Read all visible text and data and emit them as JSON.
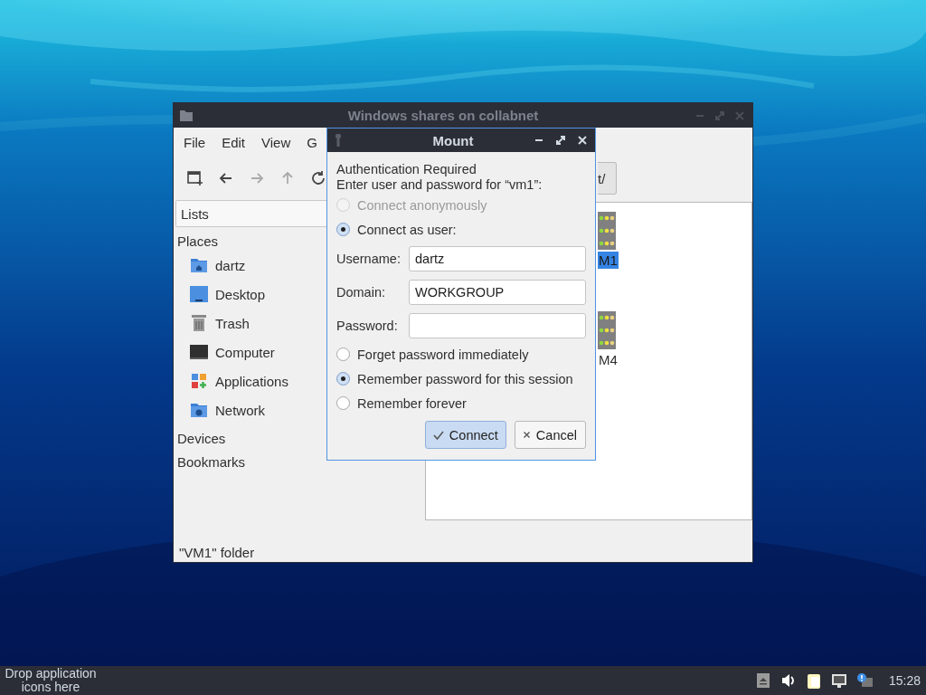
{
  "file_manager": {
    "title": "Windows shares on collabnet",
    "menu": [
      "File",
      "Edit",
      "View",
      "G"
    ],
    "path_tail": "t/",
    "sidebar": {
      "selector": "Lists",
      "sections": [
        {
          "label": "Places",
          "items": [
            {
              "label": "dartz",
              "kind": "home"
            },
            {
              "label": "Desktop",
              "kind": "desktop"
            },
            {
              "label": "Trash",
              "kind": "trash"
            },
            {
              "label": "Computer",
              "kind": "computer"
            },
            {
              "label": "Applications",
              "kind": "applications"
            },
            {
              "label": "Network",
              "kind": "network"
            }
          ]
        },
        {
          "label": "Devices"
        },
        {
          "label": "Bookmarks"
        }
      ]
    },
    "items": [
      {
        "label": "M1",
        "selected": true
      },
      {
        "label": "M4",
        "selected": false
      }
    ],
    "status": "\"VM1\" folder"
  },
  "mount_dialog": {
    "title": "Mount",
    "heading": "Authentication Required",
    "prompt": "Enter user and password for “vm1”:",
    "connect_options": [
      {
        "label": "Connect anonymously",
        "selected": false,
        "disabled": true
      },
      {
        "label": "Connect as user:",
        "selected": true,
        "disabled": false
      }
    ],
    "fields": [
      {
        "label": "Username:",
        "value": "dartz"
      },
      {
        "label": "Domain:",
        "value": "WORKGROUP"
      },
      {
        "label": "Password:"
      }
    ],
    "remember_options": [
      {
        "label": "Forget password immediately",
        "selected": false
      },
      {
        "label": "Remember password for this session",
        "selected": true
      },
      {
        "label": "Remember forever",
        "selected": false
      }
    ],
    "buttons": [
      {
        "label": "Connect",
        "kind": "default"
      },
      {
        "label": "Cancel",
        "kind": "cancel"
      }
    ]
  },
  "taskbar": {
    "launcher_hint": "Drop application icons here",
    "clock": "15:28"
  }
}
